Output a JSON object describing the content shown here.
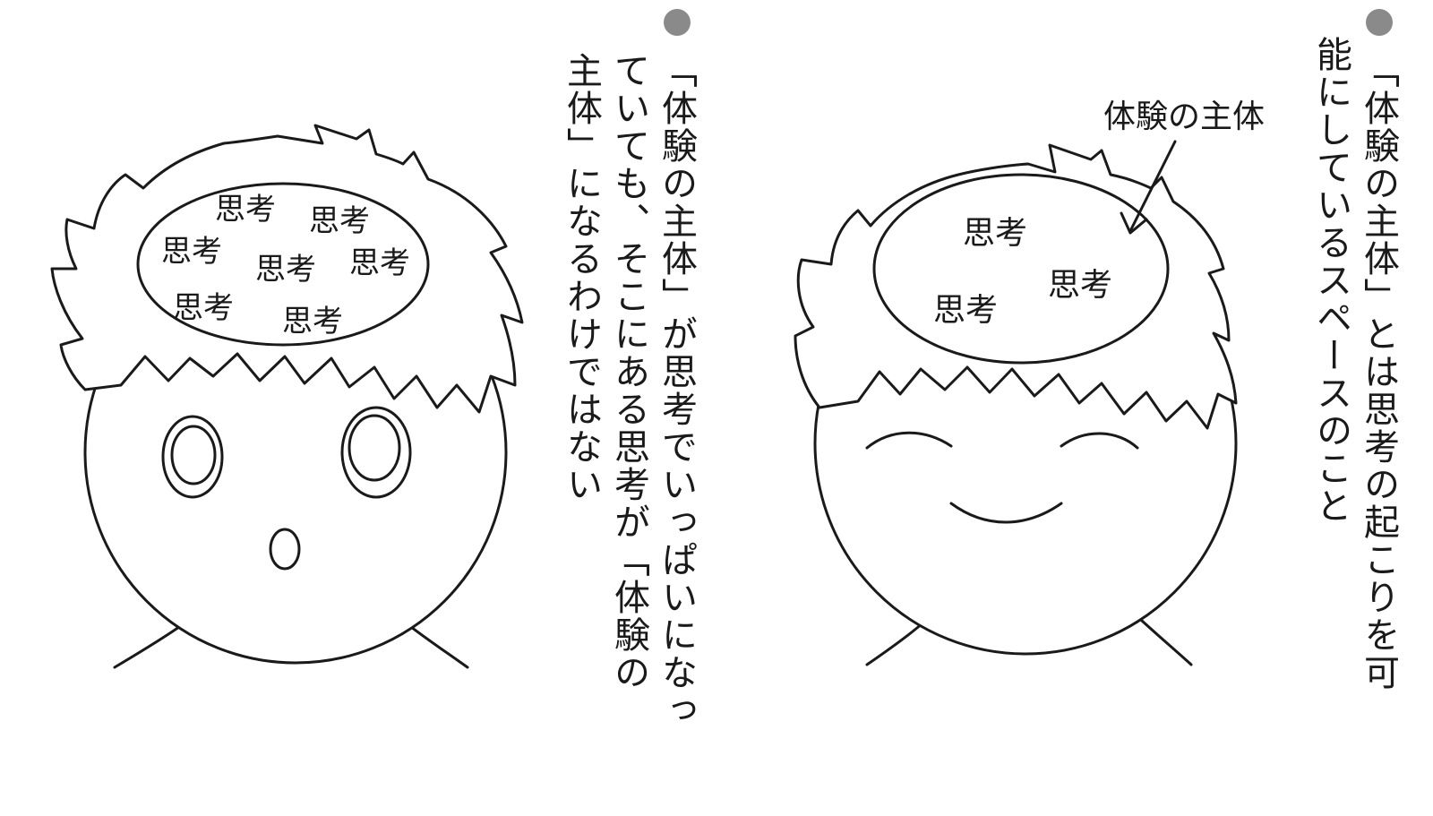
{
  "left": {
    "bullet_color": "#8a8a8a",
    "caption_lines": [
      "「体験の主体」が思考でいっぱいになっ",
      "ていても、そこにある思考が「体験の",
      "主体」になるわけではない"
    ],
    "thought_words": [
      "思考",
      "思考",
      "思考",
      "思考",
      "思考",
      "思考",
      "思考"
    ]
  },
  "right": {
    "bullet_color": "#8a8a8a",
    "caption_lines": [
      "「体験の主体」とは思考の起こりを可",
      "能にしているスペースのこと"
    ],
    "annotation_label": "体験の主体",
    "thought_words": [
      "思考",
      "思考",
      "思考"
    ]
  }
}
